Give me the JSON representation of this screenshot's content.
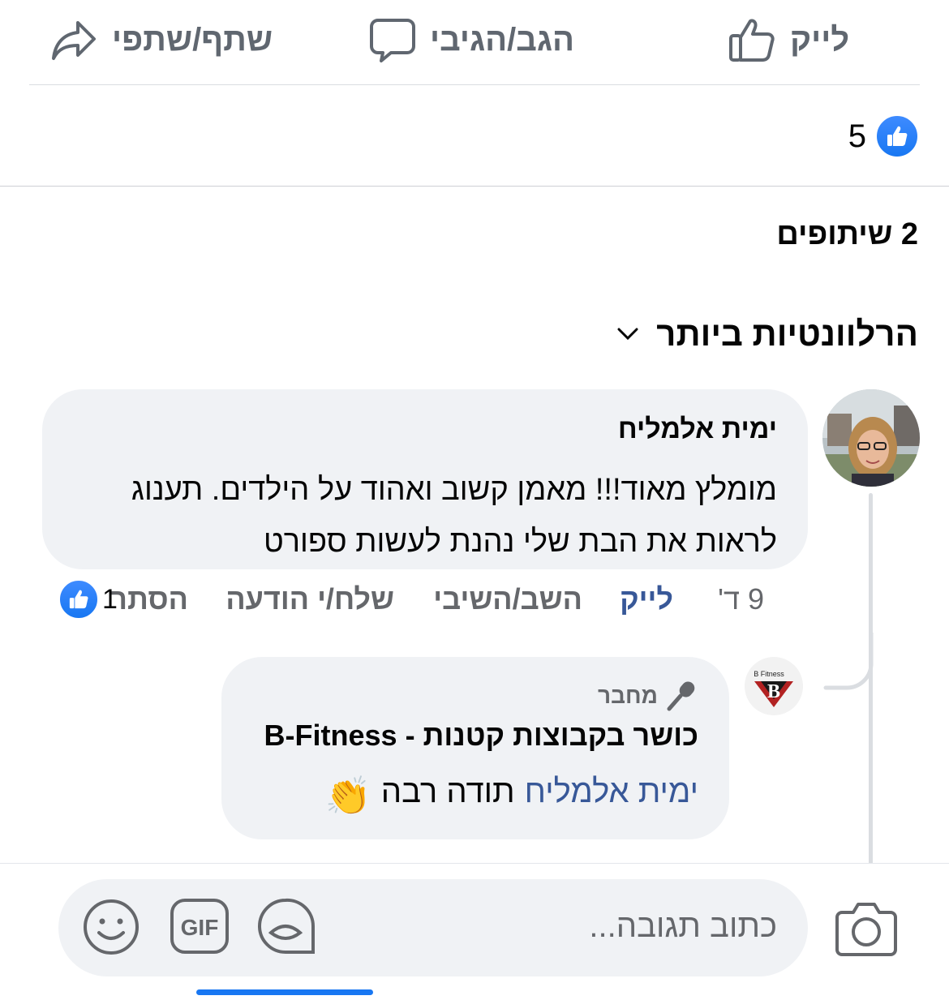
{
  "actions": {
    "like_label": "לייק",
    "comment_label": "הגב/הגיבי",
    "share_label": "שתף/שתפי"
  },
  "reactions": {
    "count": "5",
    "icon": "like-icon",
    "color": "#1877f2"
  },
  "shares": {
    "label": "2 שיתופים"
  },
  "sort": {
    "label": "הרלוונטיות ביותר",
    "icon": "chevron-down-icon"
  },
  "comments": [
    {
      "author": "ימית אלמליח",
      "line1": "מומלץ מאוד!!! מאמן קשוב ואהוד על הילדים. תענוג",
      "line2": "לראות את הבת שלי נהנת לעשות ספורט",
      "time": "9 ד'",
      "like_label": "לייק",
      "reply_label": "השב/השיבי",
      "message_label": "שלח/י הודעה",
      "hide_label": "הסתר",
      "reaction_count": "1"
    }
  ],
  "reply": {
    "badge": "מחבר",
    "author": "כושר בקבוצות קטנות - B-Fitness",
    "mention": "ימית אלמליח",
    "text": "תודה רבה",
    "emoji": "👏",
    "logo_text": "B Fitness"
  },
  "composer": {
    "placeholder": "כתוב תגובה..."
  },
  "colors": {
    "accent": "#1877f2",
    "link": "#385898",
    "secondary_text": "#65676b",
    "bubble_bg": "#f0f2f5"
  }
}
